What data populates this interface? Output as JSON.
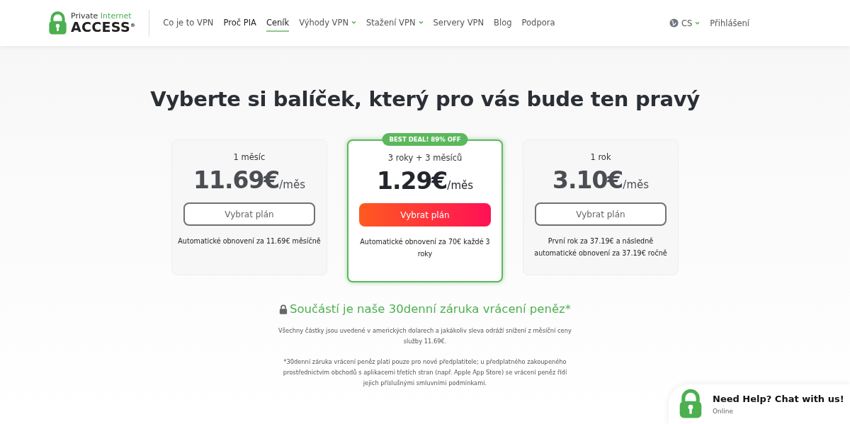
{
  "logo": {
    "top_a": "Private",
    "top_b": "Internet",
    "bottom": "ACCESS$^{®}$"
  },
  "nav": [
    {
      "label": "Co je to VPN",
      "selected": false,
      "dropdown": false,
      "emphasis": false
    },
    {
      "label": "Proč PIA",
      "selected": false,
      "dropdown": false,
      "emphasis": true
    },
    {
      "label": "Ceník",
      "selected": true,
      "dropdown": false,
      "emphasis": false
    },
    {
      "label": "Výhody VPN",
      "selected": false,
      "dropdown": true,
      "emphasis": false
    },
    {
      "label": "Stažení VPN",
      "selected": false,
      "dropdown": true,
      "emphasis": false
    },
    {
      "label": "Servery VPN",
      "selected": false,
      "dropdown": false,
      "emphasis": false
    },
    {
      "label": "Blog",
      "selected": false,
      "dropdown": false,
      "emphasis": false
    },
    {
      "label": "Podpora",
      "selected": false,
      "dropdown": false,
      "emphasis": false
    }
  ],
  "language": "CS",
  "login": "Přihlášení",
  "heading": "Vyberte si balíček, který pro vás bude ten pravý",
  "plans": [
    {
      "term": "1 měsíc",
      "price": "11.69€",
      "unit": "/měs",
      "button": "Vybrat plán",
      "note": "Automatické obnovení za 11.69€ měsíčně",
      "featured": false
    },
    {
      "term": "3 roky + 3 měsíců",
      "price": "1.29€",
      "unit": "/měs",
      "button": "Vybrat plán",
      "note": "Automatické obnovení za 70€ každé 3 roky",
      "featured": true,
      "badge": "BEST DEAL! 89% OFF"
    },
    {
      "term": "1 rok",
      "price": "3.10€",
      "unit": "/měs",
      "button": "Vybrat plán",
      "note": "První rok za 37.19€ a následně automatické obnovení za 37.19€ ročně",
      "featured": false
    }
  ],
  "guarantee": "Součástí je naše 30denní záruka vrácení peněz*",
  "footnotes": [
    "Všechny částky jsou uvedené v amerických dolarech a jakákoliv sleva odráží snížení z měsíční ceny služby 11.69€.",
    "*30denní záruka vrácení peněz platí pouze pro nové předplatitele; u předplatného zakoupeného prostřednictvím obchodů s aplikacemi třetích stran (např. Apple App Store) se vrácení peněz řídí jejich příslušnými smluvními podmínkami."
  ],
  "chat": {
    "title": "Need Help? Chat with us!",
    "status": "Online"
  }
}
